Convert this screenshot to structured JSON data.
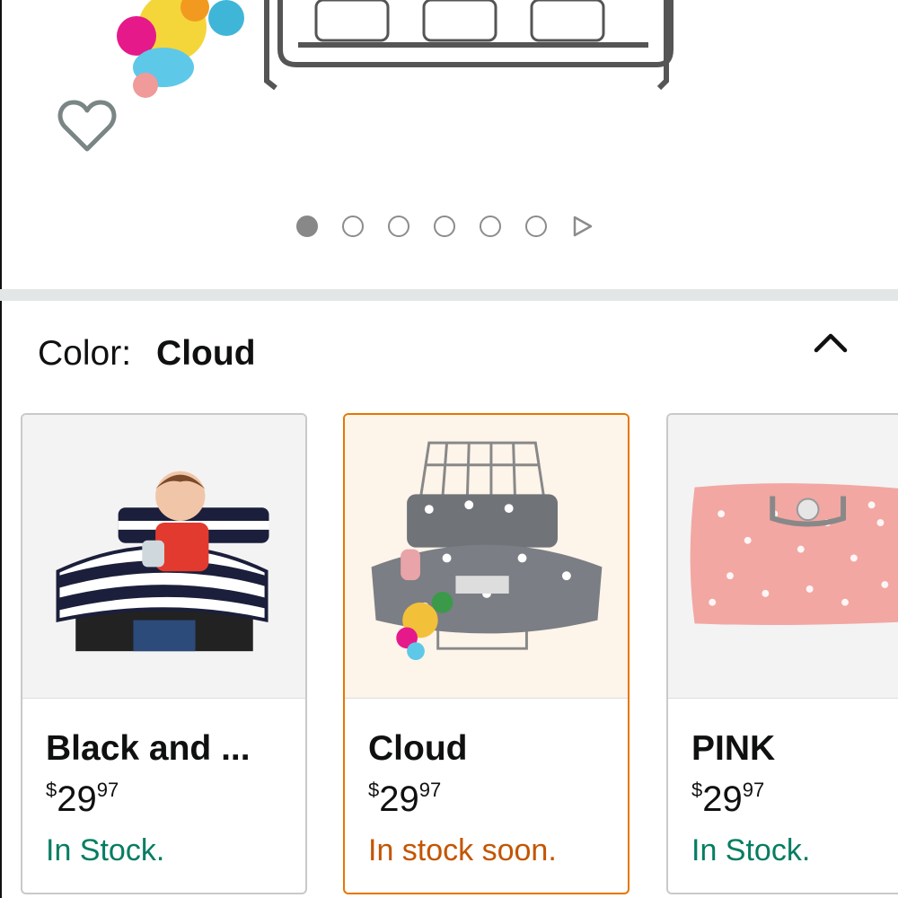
{
  "gallery": {
    "dot_count": 6,
    "active_dot": 0
  },
  "color_selector": {
    "label": "Color:",
    "selected_value": "Cloud"
  },
  "swatches": [
    {
      "name": "Black and ...",
      "price_currency": "$",
      "price_whole": "29",
      "price_fraction": "97",
      "stock": "In Stock.",
      "stock_color": "#067d62",
      "selected": false
    },
    {
      "name": "Cloud",
      "price_currency": "$",
      "price_whole": "29",
      "price_fraction": "97",
      "stock": "In stock soon.",
      "stock_color": "#c45500",
      "selected": true
    },
    {
      "name": "PINK",
      "price_currency": "$",
      "price_whole": "29",
      "price_fraction": "97",
      "stock": "In Stock.",
      "stock_color": "#067d62",
      "selected": false
    }
  ],
  "colors": {
    "selected_border": "#e77600",
    "in_stock": "#067d62",
    "coming_soon": "#c45500"
  }
}
